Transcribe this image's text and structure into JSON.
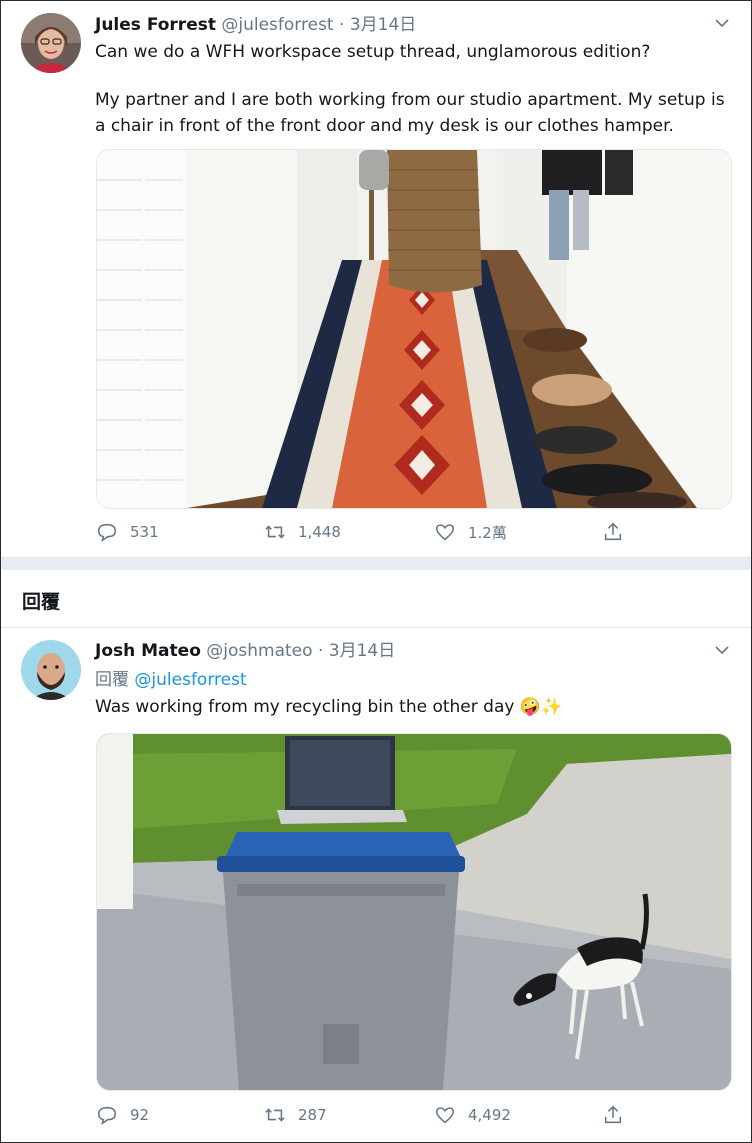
{
  "tweet1": {
    "name": "Jules Forrest",
    "handle": "@julesforrest",
    "separator": "·",
    "date": "3月14日",
    "text_line1": "Can we do a WFH workspace setup thread, unglamorous edition?",
    "text_line2": "My partner and I are both working from our studio apartment. My setup is a chair in front of the front door and my desk is our clothes hamper.",
    "replies": "531",
    "retweets": "1,448",
    "likes": "1.2萬"
  },
  "section": {
    "title": "回覆"
  },
  "tweet2": {
    "name": "Josh Mateo",
    "handle": "@joshmateo",
    "separator": "·",
    "date": "3月14日",
    "reply_label": "回覆",
    "reply_mention": "@julesforrest",
    "text": "Was working from my recycling bin the other day",
    "emoji": "🤪✨",
    "replies": "92",
    "retweets": "287",
    "likes": "4,492"
  },
  "icons": {
    "reply": "reply-icon",
    "retweet": "retweet-icon",
    "like": "heart-icon",
    "share": "share-icon",
    "more": "chevron-down-icon"
  },
  "colors": {
    "secondary_text": "#657786",
    "link": "#1b95e0",
    "divider": "#e6ecf0"
  }
}
